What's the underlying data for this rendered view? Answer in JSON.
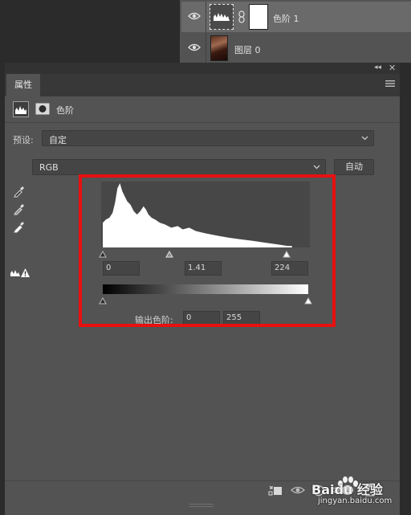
{
  "layers": [
    {
      "name": "色阶 1",
      "type": "adjustment",
      "selected": true
    },
    {
      "name": "图层 0",
      "type": "image",
      "selected": false
    }
  ],
  "properties": {
    "tab_label": "属性",
    "header_title": "色阶",
    "preset_label": "预设:",
    "preset_value": "自定",
    "channel_value": "RGB",
    "auto_label": "自动",
    "input_black": "0",
    "input_gamma": "1.41",
    "input_white": "224",
    "output_label": "输出色阶:",
    "output_black": "0",
    "output_white": "255"
  },
  "levels_values": {
    "input_black": 0,
    "input_gamma": 1.41,
    "input_white": 224,
    "output_black": 0,
    "output_white": 255
  },
  "colors": {
    "highlight_box": "#e81010",
    "panel_bg": "#535353"
  },
  "watermark": {
    "text": "Baidu 经验",
    "url": "jingyan.baidu.com"
  }
}
